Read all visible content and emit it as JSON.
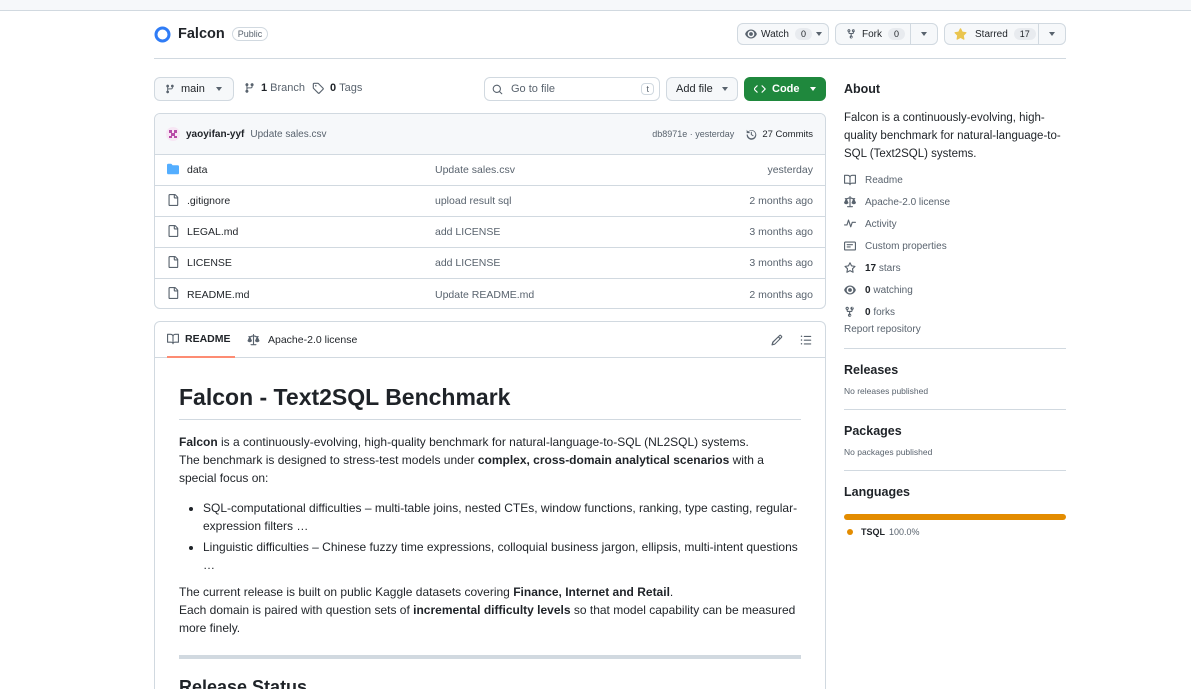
{
  "repo": {
    "name": "Falcon",
    "visibility": "Public",
    "watch": {
      "label": "Watch",
      "count": "0"
    },
    "fork": {
      "label": "Fork",
      "count": "0"
    },
    "star": {
      "label": "Starred",
      "count": "17"
    }
  },
  "toolbar": {
    "branch": "main",
    "branches_count": "1",
    "branches_label": "Branch",
    "tags_count": "0",
    "tags_label": "Tags",
    "go_to_file_placeholder": "Go to file",
    "go_to_file_key": "t",
    "add_file_label": "Add file",
    "code_label": "Code"
  },
  "commit": {
    "author": "yaoyifan-yyf",
    "message": "Update sales.csv",
    "hash_time": "db8971e · yesterday",
    "commits_label": "27 Commits"
  },
  "files": [
    {
      "name": "data",
      "type": "folder",
      "message": "Update sales.csv",
      "date": "yesterday"
    },
    {
      "name": ".gitignore",
      "type": "file",
      "message": "upload result sql",
      "date": "2 months ago"
    },
    {
      "name": "LEGAL.md",
      "type": "file",
      "message": "add LICENSE",
      "date": "3 months ago"
    },
    {
      "name": "LICENSE",
      "type": "file",
      "message": "add LICENSE",
      "date": "3 months ago"
    },
    {
      "name": "README.md",
      "type": "file",
      "message": "Update README.md",
      "date": "2 months ago"
    }
  ],
  "readme": {
    "tab_readme": "README",
    "tab_license": "Apache-2.0 license",
    "title": "Falcon - Text2SQL Benchmark",
    "p1_bold": "Falcon",
    "p1_text": " is a continuously-evolving, high-quality benchmark for natural-language-to-SQL (NL2SQL) systems.",
    "p1_text2": "The benchmark is designed to stress-test models under ",
    "p1_bold2": "complex, cross-domain analytical scenarios",
    "p1_text3": " with a special focus on:",
    "bullets": [
      "SQL-computational difficulties – multi-table joins, nested CTEs, window functions, ranking, type casting, regular-expression filters …",
      "Linguistic difficulties – Chinese fuzzy time expressions, colloquial business jargon, ellipsis, multi-intent questions …"
    ],
    "p2_text": "The current release is built on public Kaggle datasets covering ",
    "p2_bold": "Finance, Internet and Retail",
    "p2_end": ".",
    "p3_text": "Each domain is paired with question sets of ",
    "p3_bold": "incremental difficulty levels",
    "p3_text2": " so that model capability can be measured more finely.",
    "h2": "Release Status"
  },
  "sidebar": {
    "about_title": "About",
    "description": "Falcon is a continuously-evolving, high-quality benchmark for natural-language-to-SQL (Text2SQL) systems.",
    "links": [
      {
        "icon": "book-icon",
        "label": "Readme",
        "bold": ""
      },
      {
        "icon": "scale-icon",
        "label": "Apache-2.0 license",
        "bold": ""
      },
      {
        "icon": "pulse-icon",
        "label": "Activity",
        "bold": ""
      },
      {
        "icon": "note-icon",
        "label": "Custom properties",
        "bold": ""
      },
      {
        "icon": "star-icon",
        "label": " stars",
        "bold": "17"
      },
      {
        "icon": "eye-icon",
        "label": " watching",
        "bold": "0"
      },
      {
        "icon": "fork-icon",
        "label": " forks",
        "bold": "0"
      }
    ],
    "report": "Report repository",
    "releases_title": "Releases",
    "releases_empty": "No releases published",
    "packages_title": "Packages",
    "packages_empty": "No packages published",
    "languages_title": "Languages",
    "language": {
      "name": "TSQL",
      "percent": "100.0%",
      "color": "#e38c00",
      "fraction": 1.0
    }
  },
  "colors": {
    "accent_green": "#1f883d",
    "star_yellow": "#eac54f",
    "folder_blue": "#54aeff"
  }
}
